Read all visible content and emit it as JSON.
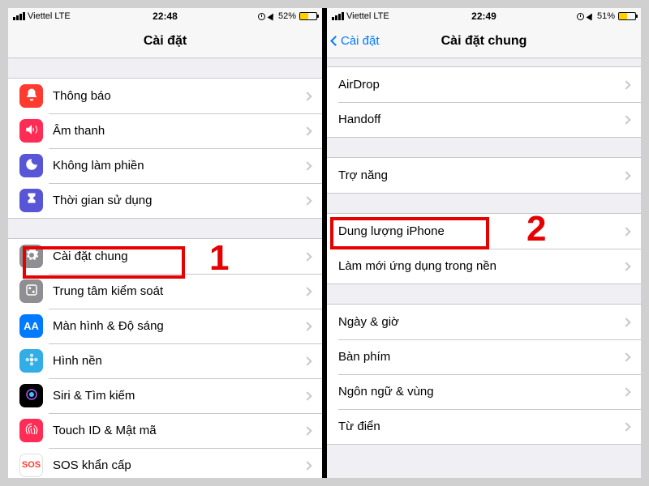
{
  "left": {
    "status": {
      "carrier": "Viettel",
      "network": "LTE",
      "time": "22:48",
      "battery_pct": "52%",
      "battery_fill": 52
    },
    "nav": {
      "title": "Cài đặt"
    },
    "groupA": [
      {
        "id": "notifications",
        "label": "Thông báo",
        "icon": "bell",
        "color": "ic-red"
      },
      {
        "id": "sounds",
        "label": "Âm thanh",
        "icon": "speaker",
        "color": "ic-pink"
      },
      {
        "id": "dnd",
        "label": "Không làm phiền",
        "icon": "moon",
        "color": "ic-purple"
      },
      {
        "id": "screentime",
        "label": "Thời gian sử dụng",
        "icon": "hourglass",
        "color": "ic-indigo"
      }
    ],
    "groupB": [
      {
        "id": "general",
        "label": "Cài đặt chung",
        "icon": "gear",
        "color": "ic-gray"
      },
      {
        "id": "controlcenter",
        "label": "Trung tâm kiểm soát",
        "icon": "sliders",
        "color": "ic-gray"
      },
      {
        "id": "display",
        "label": "Màn hình & Độ sáng",
        "icon": "aa",
        "color": "ic-blue"
      },
      {
        "id": "wallpaper",
        "label": "Hình nền",
        "icon": "flower",
        "color": "ic-cyan"
      },
      {
        "id": "siri",
        "label": "Siri & Tìm kiếm",
        "icon": "siri",
        "color": "ic-dark"
      },
      {
        "id": "touchid",
        "label": "Touch ID & Mật mã",
        "icon": "finger",
        "color": "ic-pink"
      },
      {
        "id": "sos",
        "label": "SOS khẩn cấp",
        "icon": "sos",
        "color": "ic-red"
      }
    ],
    "highlight_step": "1"
  },
  "right": {
    "status": {
      "carrier": "Viettel",
      "network": "LTE",
      "time": "22:49",
      "battery_pct": "51%",
      "battery_fill": 51
    },
    "nav": {
      "title": "Cài đặt chung",
      "back": "Cài đặt"
    },
    "groupA": [
      {
        "id": "airdrop",
        "label": "AirDrop"
      },
      {
        "id": "handoff",
        "label": "Handoff"
      }
    ],
    "groupB": [
      {
        "id": "accessibility",
        "label": "Trợ năng"
      }
    ],
    "groupC": [
      {
        "id": "storage",
        "label": "Dung lượng iPhone"
      },
      {
        "id": "refresh",
        "label": "Làm mới ứng dụng trong nền"
      }
    ],
    "groupD": [
      {
        "id": "datetime",
        "label": "Ngày & giờ"
      },
      {
        "id": "keyboard",
        "label": "Bàn phím"
      },
      {
        "id": "language",
        "label": "Ngôn ngữ & vùng"
      },
      {
        "id": "dictionary",
        "label": "Từ điển"
      }
    ],
    "highlight_step": "2"
  }
}
